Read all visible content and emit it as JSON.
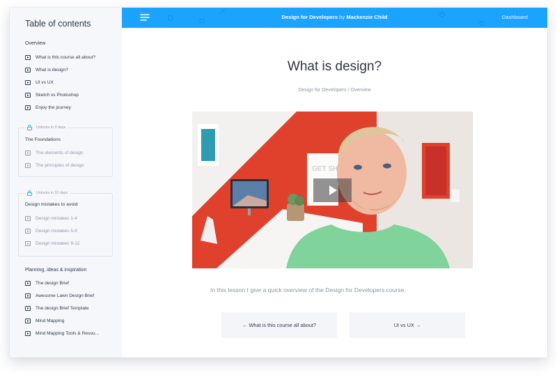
{
  "sidebar": {
    "title": "Table of contents",
    "overview": {
      "heading": "Overview",
      "items": [
        {
          "label": "What is this course all about?"
        },
        {
          "label": "What is design?"
        },
        {
          "label": "UI vs UX"
        },
        {
          "label": "Sketch vs Photoshop"
        },
        {
          "label": "Enjoy the journey"
        }
      ]
    },
    "foundations": {
      "unlock_text": "Unlocks in 3 days",
      "title": "The Foundations",
      "items": [
        {
          "label": "The elements of design"
        },
        {
          "label": "The principles of design"
        }
      ]
    },
    "mistakes": {
      "unlock_text": "Unlocks in 10 days",
      "title": "Design mistakes to avoid",
      "items": [
        {
          "label": "Design mistakes 1-4"
        },
        {
          "label": "Design mistakes 5-8"
        },
        {
          "label": "Design mistakes 9-12"
        }
      ]
    },
    "planning": {
      "heading": "Planning, ideas & inspiration",
      "items": [
        {
          "label": "The design Brief"
        },
        {
          "label": "Awesome Lawn Design Brief"
        },
        {
          "label": "The design Brief Template"
        },
        {
          "label": "Mind Mapping"
        },
        {
          "label": "Mind Mapping Tools & Resou..."
        }
      ]
    }
  },
  "header": {
    "course": "Design for Developers",
    "by": "by",
    "author": "Mackenzie Child",
    "dashboard": "Dashboard"
  },
  "main": {
    "title": "What is design?",
    "breadcrumb": {
      "course": "Design for Developers",
      "sep": "/",
      "section": "Overview"
    },
    "video_poster_text": "GET SHIT",
    "description": "In this lesson I give a quick overview of the Design for Developers course.",
    "prev_button": "← What is this course all about?",
    "next_button": "UI vs UX →"
  },
  "colors": {
    "accent": "#1aa3ff",
    "sidebar_bg": "#f5f7fb",
    "text": "#2f3a4a",
    "muted": "#8e99ab"
  }
}
